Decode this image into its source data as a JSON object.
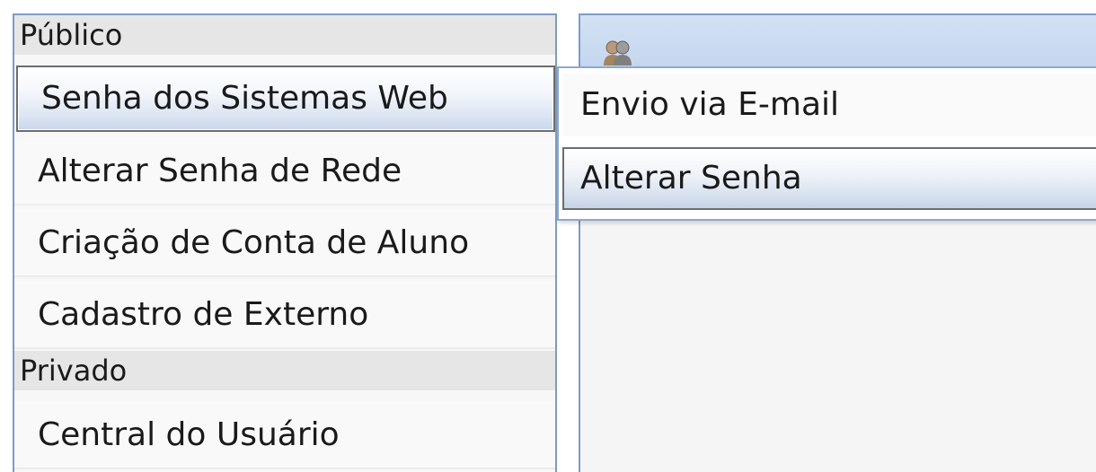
{
  "nav": {
    "groups": [
      {
        "header": "Público",
        "items": [
          {
            "label": "Senha dos Sistemas Web"
          },
          {
            "label": "Alterar Senha de Rede"
          },
          {
            "label": "Criação de Conta de Aluno"
          },
          {
            "label": "Cadastro de Externo"
          }
        ]
      },
      {
        "header": "Privado",
        "items": [
          {
            "label": "Central do Usuário"
          }
        ]
      }
    ],
    "selected": "Senha dos Sistemas Web"
  },
  "flyout": {
    "items": [
      {
        "label": "Envio via E-mail"
      },
      {
        "label": "Alterar Senha"
      }
    ],
    "highlighted": "Alterar Senha"
  },
  "content": {
    "header_icon": "users-icon"
  },
  "colors": {
    "panel_border": "#7c9cc4",
    "group_header_bg": "#e6e6e6",
    "content_header_bg": "#c1d4ee",
    "selection_border": "#6d6d6d"
  }
}
